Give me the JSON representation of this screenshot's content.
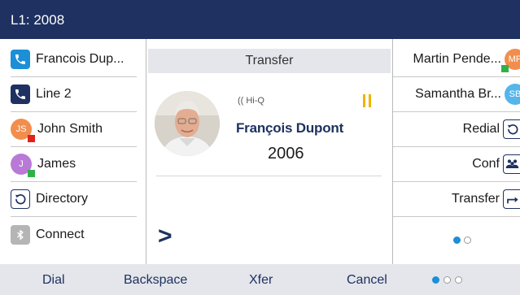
{
  "titlebar": {
    "title": "L1: 2008"
  },
  "left_keys": [
    {
      "label": "Francois Dup...",
      "icon": "phone-icon"
    },
    {
      "label": "Line 2",
      "icon": "phone-icon"
    },
    {
      "label": "John Smith",
      "avatar": "JS",
      "presence": "busy"
    },
    {
      "label": "James",
      "avatar": "J",
      "presence": "available"
    },
    {
      "label": "Directory",
      "icon": "directory-icon"
    },
    {
      "label": "Connect",
      "icon": "bluetooth-icon"
    }
  ],
  "call": {
    "header": "Transfer",
    "hd_badge": "Hi-Q",
    "caller_name": "François Dupont",
    "caller_number": "2006",
    "prompt": ">",
    "status_icon": "hold-icon"
  },
  "right_keys": [
    {
      "label": "Martin Pende...",
      "avatar": "MP",
      "presence": "available"
    },
    {
      "label": "Samantha Br...",
      "avatar": "SB"
    },
    {
      "label": "Redial",
      "icon": "redial-icon"
    },
    {
      "label": "Conf",
      "icon": "conference-icon"
    },
    {
      "label": "Transfer",
      "icon": "transfer-icon"
    }
  ],
  "right_pager": {
    "page": 1,
    "total": 2
  },
  "softkeys": {
    "dial": "Dial",
    "backspace": "Backspace",
    "xfer": "Xfer",
    "cancel": "Cancel",
    "pager": {
      "page": 1,
      "total": 3
    }
  },
  "colors": {
    "titlebar": "#1e3160",
    "accent": "#1c8fd7",
    "softkey_bar": "#e4e6eb",
    "busy": "#e0231b",
    "available": "#2fb14a",
    "hold": "#f0b400"
  }
}
